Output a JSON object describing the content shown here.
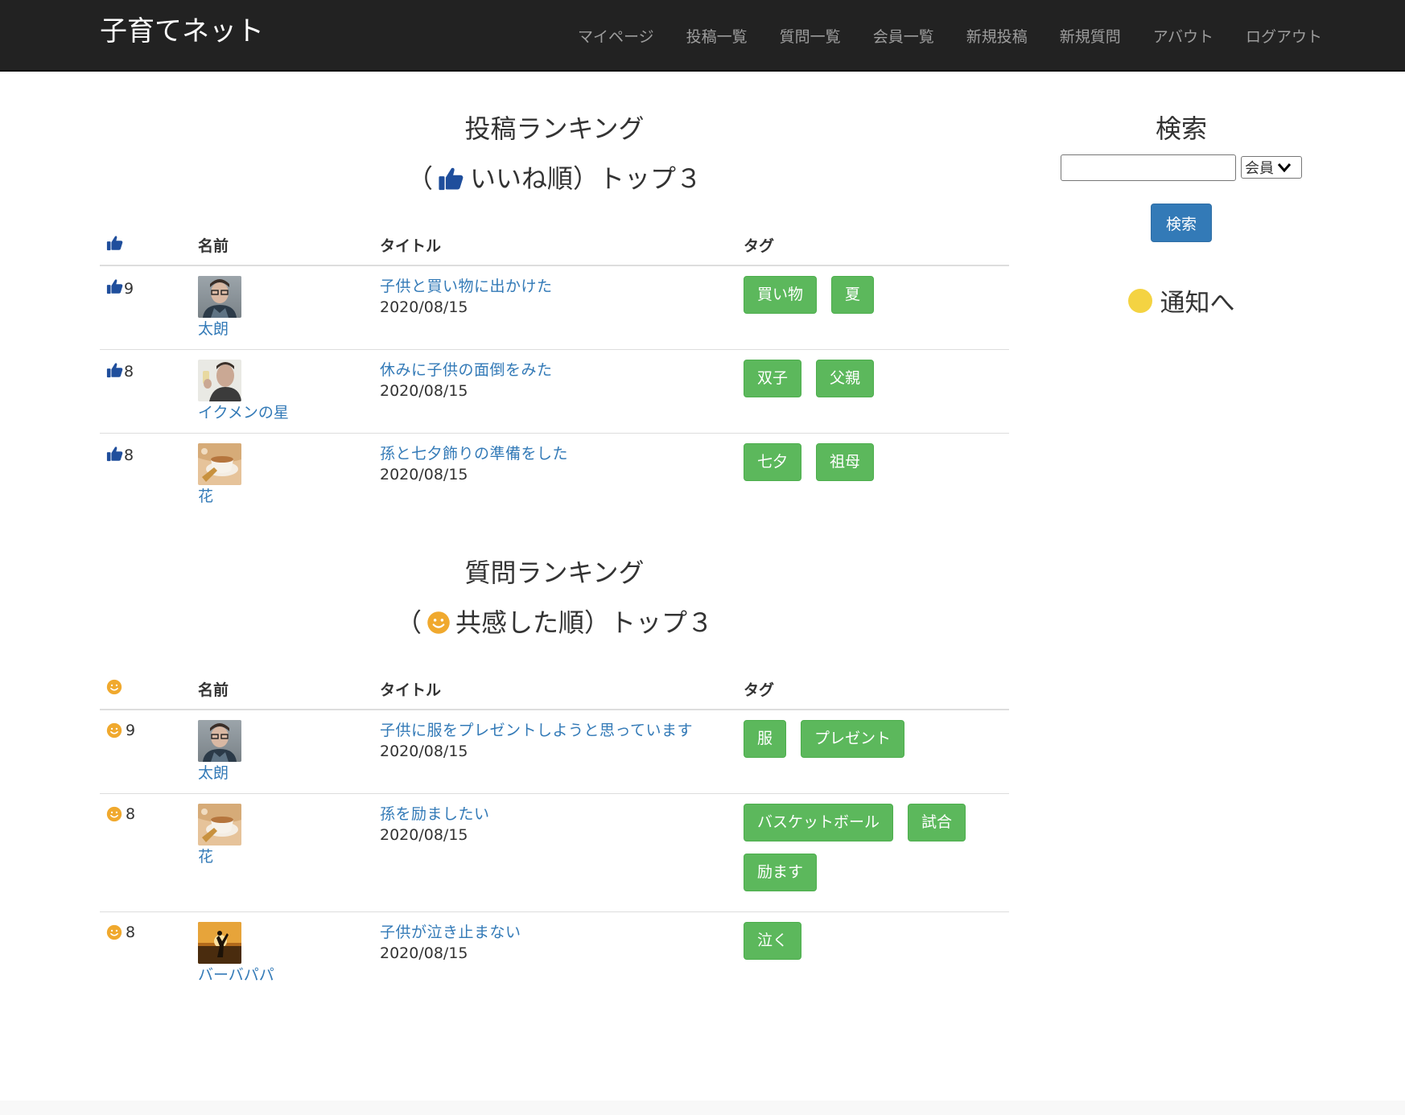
{
  "header": {
    "brand": "子育てネット",
    "nav": [
      "マイページ",
      "投稿一覧",
      "質問一覧",
      "会員一覧",
      "新規投稿",
      "新規質問",
      "アバウト",
      "ログアウト"
    ]
  },
  "post_ranking": {
    "title": "投稿ランキング",
    "subtitle_open": "（",
    "subtitle_rest": "いいね順）トップ３",
    "columns": {
      "name": "名前",
      "title": "タイトル",
      "tags": "タグ"
    },
    "rows": [
      {
        "score": "9",
        "user": "太朗",
        "avatar": "avatar-man-glasses",
        "post_title": "子供と買い物に出かけた",
        "date": "2020/08/15",
        "tags": [
          "買い物",
          "夏"
        ]
      },
      {
        "score": "8",
        "user": "イクメンの星",
        "avatar": "avatar-man-phone",
        "post_title": "休みに子供の面倒をみた",
        "date": "2020/08/15",
        "tags": [
          "双子",
          "父親"
        ]
      },
      {
        "score": "8",
        "user": "花",
        "avatar": "avatar-coffee-cup",
        "post_title": "孫と七夕飾りの準備をした",
        "date": "2020/08/15",
        "tags": [
          "七夕",
          "祖母"
        ]
      }
    ]
  },
  "question_ranking": {
    "title": "質問ランキング",
    "subtitle_open": "（",
    "subtitle_rest": "共感した順）トップ３",
    "columns": {
      "name": "名前",
      "title": "タイトル",
      "tags": "タグ"
    },
    "rows": [
      {
        "score": "9",
        "user": "太朗",
        "avatar": "avatar-man-glasses",
        "post_title": "子供に服をプレゼントしようと思っています",
        "date": "2020/08/15",
        "tags": [
          "服",
          "プレゼント"
        ]
      },
      {
        "score": "8",
        "user": "花",
        "avatar": "avatar-coffee-cup",
        "post_title": "孫を励ましたい",
        "date": "2020/08/15",
        "tags": [
          "バスケットボール",
          "試合",
          "励ます"
        ]
      },
      {
        "score": "8",
        "user": "バーバパパ",
        "avatar": "avatar-sunset-silhouette",
        "post_title": "子供が泣き止まない",
        "date": "2020/08/15",
        "tags": [
          "泣く"
        ]
      }
    ]
  },
  "sidebar": {
    "search_title": "検索",
    "search_value": "",
    "select_value": "会員",
    "search_button": "検索",
    "notify_label": "通知へ"
  },
  "colors": {
    "navbar": "#222222",
    "link": "#337ab7",
    "tag": "#5cb85c",
    "button": "#337ab7",
    "thumb": "#1f4e9c",
    "smile": "#f0a92e",
    "notify_dot": "#f4d342"
  },
  "icons": {
    "like": "thumbs-up-icon",
    "empathy": "smiley-icon",
    "notify": "yellow-dot-icon"
  }
}
